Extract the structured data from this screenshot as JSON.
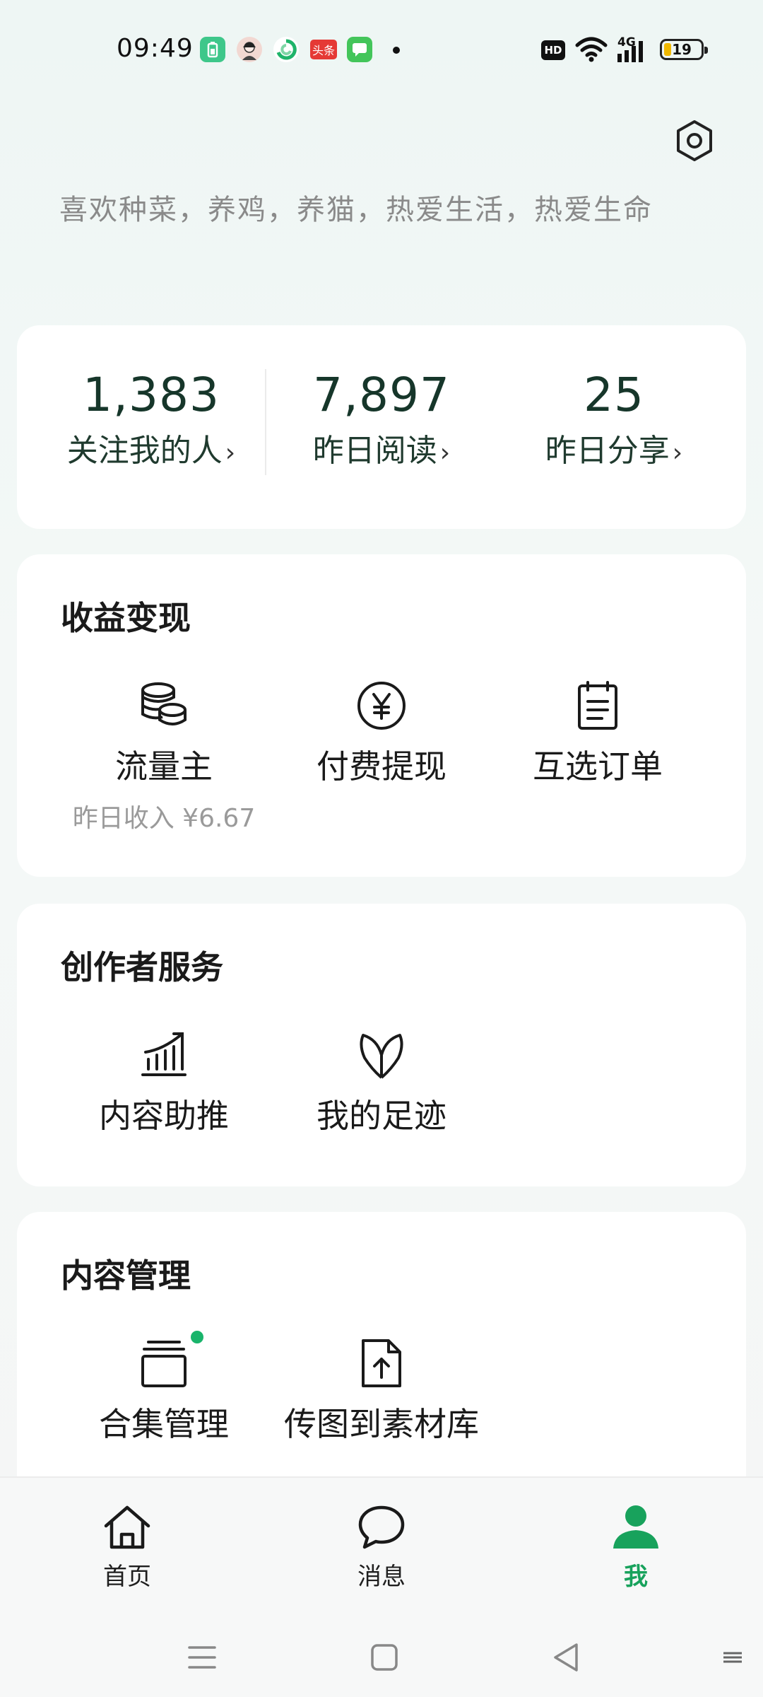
{
  "status_bar": {
    "time": "09:49",
    "apps": [
      {
        "icon": "battery-saver-app-icon",
        "color": "#3ec78a",
        "text": ""
      },
      {
        "icon": "avatar-app-icon",
        "color": "#f2d8d2",
        "text": ""
      },
      {
        "icon": "green-swirl-app-icon",
        "color": "#ffffff",
        "text": ""
      },
      {
        "icon": "toutiao-app-icon",
        "color": "#e53935",
        "text": "头条"
      },
      {
        "icon": "messages-app-icon",
        "color": "#43c55a",
        "text": ""
      }
    ],
    "hd": "HD",
    "network": "4G",
    "battery": "19",
    "battery_level": 0.19
  },
  "profile": {
    "bio": "喜欢种菜，养鸡，养猫，热爱生活，热爱生命"
  },
  "stats": [
    {
      "value": "1,383",
      "label": "关注我的人"
    },
    {
      "value": "7,897",
      "label": "昨日阅读"
    },
    {
      "value": "25",
      "label": "昨日分享"
    }
  ],
  "monetization": {
    "title": "收益变现",
    "items": [
      {
        "label": "流量主",
        "sub": "昨日收入 ¥6.67",
        "icon": "coins-icon"
      },
      {
        "label": "付费提现",
        "icon": "yuan-icon"
      },
      {
        "label": "互选订单",
        "icon": "clipboard-icon"
      }
    ]
  },
  "creator": {
    "title": "创作者服务",
    "items": [
      {
        "label": "内容助推",
        "icon": "growth-chart-icon"
      },
      {
        "label": "我的足迹",
        "icon": "sprout-icon"
      }
    ]
  },
  "content": {
    "title": "内容管理",
    "items": [
      {
        "label": "合集管理",
        "icon": "collection-icon"
      },
      {
        "label": "传图到素材库",
        "icon": "upload-file-icon"
      }
    ]
  },
  "tabs": [
    {
      "label": "首页",
      "icon": "home-icon"
    },
    {
      "label": "消息",
      "icon": "message-icon"
    },
    {
      "label": "我",
      "icon": "person-icon"
    }
  ],
  "colors": {
    "accent": "#18a25c",
    "number": "#16362a",
    "badge": "#19b46b"
  }
}
